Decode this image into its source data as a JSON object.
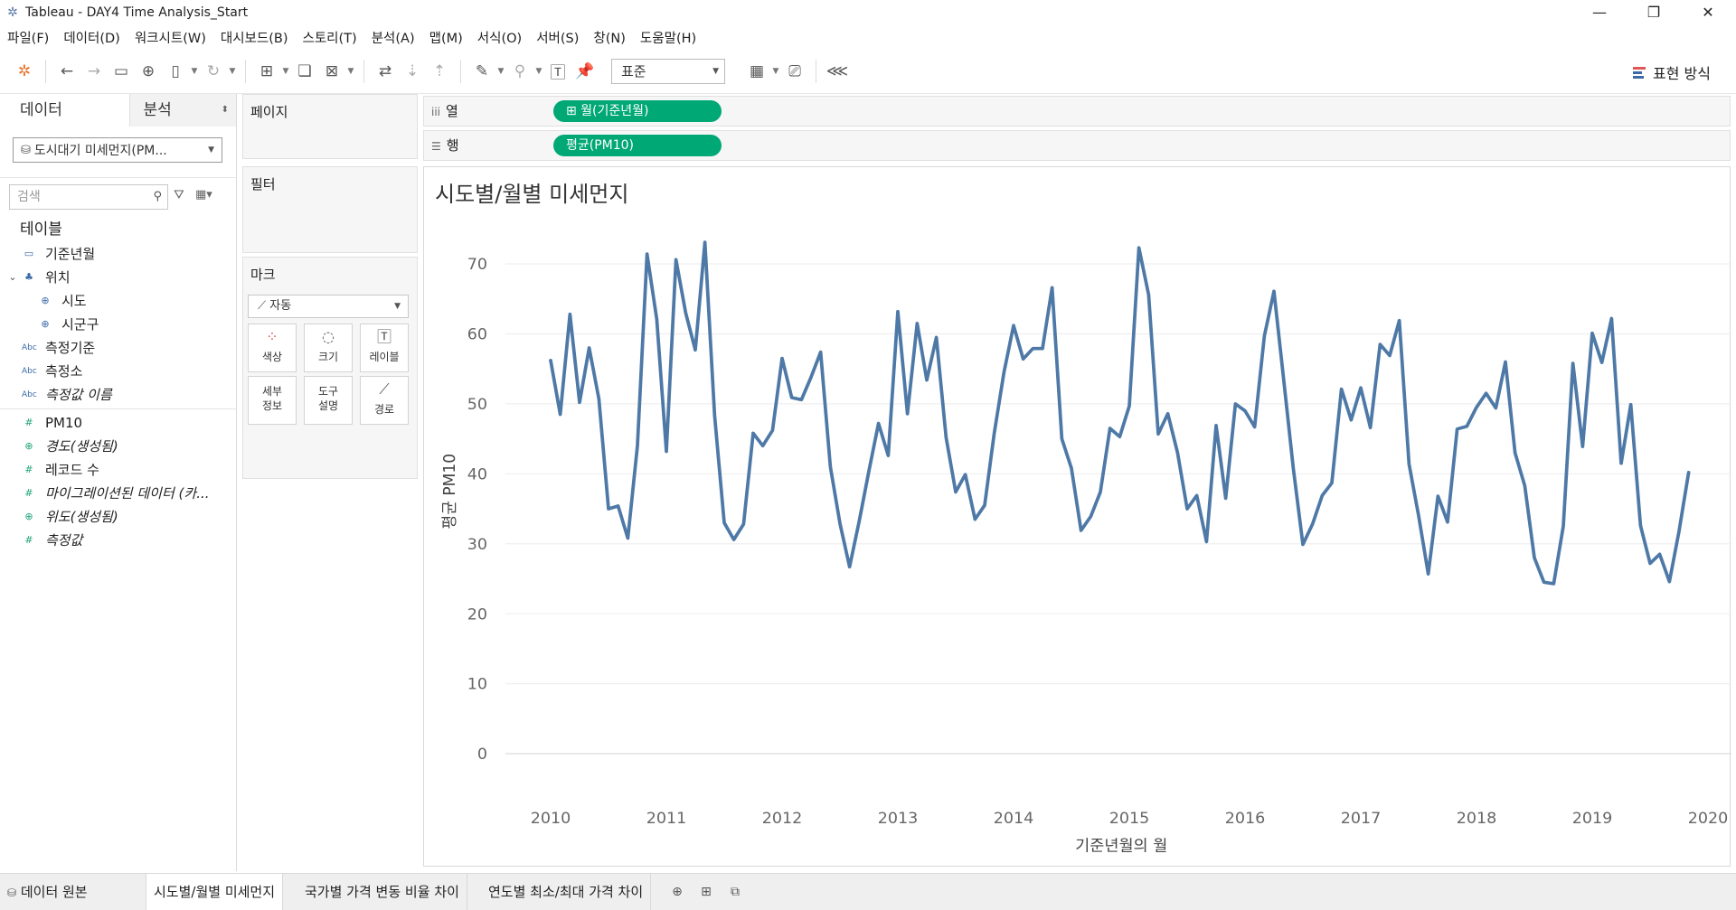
{
  "window": {
    "title": "Tableau - DAY4 Time Analysis_Start"
  },
  "menu": [
    "파일(F)",
    "데이터(D)",
    "워크시트(W)",
    "대시보드(B)",
    "스토리(T)",
    "분석(A)",
    "맵(M)",
    "서식(O)",
    "서버(S)",
    "창(N)",
    "도움말(H)"
  ],
  "toolbar": {
    "fit_select": "표준",
    "show_me": "표현 방식"
  },
  "data_pane": {
    "tab_data": "데이터",
    "tab_analysis": "분석",
    "datasource": "도시대기 미세먼지(PM...",
    "search_placeholder": "검색",
    "section_tables": "테이블",
    "fields": [
      {
        "label": "기준년월",
        "type": "date",
        "italic": false,
        "indent": 0
      },
      {
        "label": "위치",
        "type": "hierarchy",
        "italic": false,
        "indent": 0
      },
      {
        "label": "시도",
        "type": "geo",
        "italic": false,
        "indent": 1
      },
      {
        "label": "시군구",
        "type": "geo",
        "italic": false,
        "indent": 1
      },
      {
        "label": "측정기준",
        "type": "abc",
        "italic": false,
        "indent": 0
      },
      {
        "label": "측정소",
        "type": "abc",
        "italic": false,
        "indent": 0
      },
      {
        "label": "측정값 이름",
        "type": "abc",
        "italic": true,
        "indent": 0
      }
    ],
    "measures": [
      {
        "label": "PM10",
        "type": "measure",
        "italic": false
      },
      {
        "label": "경도(생성됨)",
        "type": "geo-measure",
        "italic": true
      },
      {
        "label": "레코드 수",
        "type": "measure",
        "italic": false
      },
      {
        "label": "마이그레이션된 데이터 (카...",
        "type": "measure",
        "italic": true
      },
      {
        "label": "위도(생성됨)",
        "type": "geo-measure",
        "italic": true
      },
      {
        "label": "측정값",
        "type": "measure",
        "italic": true
      }
    ]
  },
  "cards": {
    "pages": "페이지",
    "filters": "필터",
    "marks": "마크",
    "mark_type": "자동",
    "mark_buttons": [
      "색상",
      "크기",
      "레이블",
      "세부\n정보",
      "도구\n설명",
      "경로"
    ]
  },
  "shelves": {
    "columns_label": "열",
    "columns_pill": "⊞ 월(기준년월)",
    "rows_label": "행",
    "rows_pill": "평균(PM10)"
  },
  "view": {
    "title": "시도별/월별 미세먼지"
  },
  "chart_data": {
    "type": "line",
    "title": "시도별/월별 미세먼지",
    "xlabel": "기준년월의 월",
    "ylabel": "평균 PM10",
    "x_start": "2010-01",
    "x_ticks": [
      "2010",
      "2011",
      "2012",
      "2013",
      "2014",
      "2015",
      "2016",
      "2017",
      "2018",
      "2019",
      "2020"
    ],
    "y_ticks": [
      0,
      10,
      20,
      30,
      40,
      50,
      60,
      70
    ],
    "ylim": [
      0,
      75
    ],
    "color": "#4e79a7",
    "series": [
      {
        "values": [
          56.2,
          48.5,
          62.8,
          50.2,
          58.0,
          50.7,
          35.0,
          35.4,
          30.8,
          44.0,
          71.4,
          62.1,
          43.2,
          70.6,
          63.0,
          57.7,
          73.1,
          48.3,
          33.0,
          30.6,
          32.8,
          45.8,
          44.0,
          46.2,
          56.5,
          50.9,
          50.6,
          53.8,
          57.4,
          41.0,
          32.9,
          26.7,
          33.3,
          40.4,
          47.2,
          42.6,
          63.2,
          48.6,
          61.5,
          53.4,
          59.5,
          45.2,
          37.4,
          39.9,
          33.5,
          35.5,
          45.8,
          54.5,
          61.2,
          56.4,
          57.9,
          57.9,
          66.6,
          45.0,
          40.8,
          31.9,
          33.9,
          37.4,
          46.5,
          45.3,
          49.7,
          72.3,
          65.6,
          45.7,
          48.6,
          43.0,
          35.0,
          36.9,
          30.3,
          46.9,
          36.5,
          50.0,
          49.0,
          46.7,
          59.7,
          66.1,
          53.6,
          40.8,
          29.9,
          32.8,
          36.9,
          38.7,
          52.1,
          47.7,
          52.3,
          46.6,
          58.5,
          56.9,
          61.9,
          41.4,
          34.0,
          25.7,
          36.8,
          33.1,
          46.4,
          46.8,
          49.5,
          51.5,
          49.4,
          56.0,
          43.0,
          38.3,
          28.0,
          24.5,
          24.3,
          32.5,
          55.8,
          43.9,
          60.1,
          55.9,
          62.2,
          41.5,
          49.9,
          32.6,
          27.2,
          28.5,
          24.6,
          31.8,
          40.2
        ]
      }
    ]
  },
  "bottom_tabs": [
    "데이터 원본",
    "시도별/월별 미세먼지",
    "국가별 가격 변동 비율 차이",
    "연도별 최소/최대 가격 차이"
  ]
}
